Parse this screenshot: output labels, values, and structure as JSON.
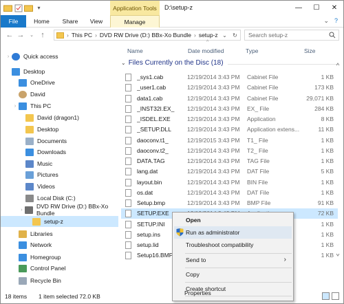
{
  "window": {
    "title": "D:\\setup-z",
    "contextual_group": "Application Tools",
    "controls": [
      "minimize",
      "maximize",
      "close"
    ]
  },
  "ribbon": {
    "tabs": [
      "File",
      "Home",
      "Share",
      "View",
      "Manage"
    ],
    "file_tab_color": "#1979ca",
    "contextual_color": "#f8e8a0"
  },
  "address": {
    "path": [
      "This PC",
      "DVD RW Drive (D:) BBx-Xo Bundle",
      "setup-z"
    ],
    "search_placeholder": "Search setup-z"
  },
  "nav": {
    "items": [
      {
        "label": "Quick access",
        "icon": "star-icon",
        "indent": 0
      },
      {
        "label": "Desktop",
        "icon": "desktop-icon",
        "indent": 0
      },
      {
        "label": "OneDrive",
        "icon": "cloud-icon",
        "indent": 1
      },
      {
        "label": "David",
        "icon": "user-icon",
        "indent": 1
      },
      {
        "label": "This PC",
        "icon": "computer-icon",
        "indent": 1
      },
      {
        "label": "David (dragon1)",
        "icon": "folder-icon",
        "indent": 2
      },
      {
        "label": "Desktop",
        "icon": "folder-icon",
        "indent": 2
      },
      {
        "label": "Documents",
        "icon": "documents-icon",
        "indent": 2
      },
      {
        "label": "Downloads",
        "icon": "downloads-icon",
        "indent": 2
      },
      {
        "label": "Music",
        "icon": "music-icon",
        "indent": 2
      },
      {
        "label": "Pictures",
        "icon": "pictures-icon",
        "indent": 2
      },
      {
        "label": "Videos",
        "icon": "videos-icon",
        "indent": 2
      },
      {
        "label": "Local Disk (C:)",
        "icon": "drive-icon",
        "indent": 2
      },
      {
        "label": "DVD RW Drive (D:) BBx-Xo Bundle",
        "icon": "dvd-icon",
        "indent": 2
      },
      {
        "label": "setup-z",
        "icon": "folder-icon",
        "indent": 3,
        "selected": true
      },
      {
        "label": "Libraries",
        "icon": "libraries-icon",
        "indent": 1
      },
      {
        "label": "Network",
        "icon": "network-icon",
        "indent": 1
      },
      {
        "label": "Homegroup",
        "icon": "homegroup-icon",
        "indent": 1
      },
      {
        "label": "Control Panel",
        "icon": "control-panel-icon",
        "indent": 1
      },
      {
        "label": "Recycle Bin",
        "icon": "recycle-bin-icon",
        "indent": 1
      }
    ]
  },
  "columns": {
    "name": "Name",
    "date": "Date modified",
    "type": "Type",
    "size": "Size"
  },
  "group": {
    "label": "Files Currently on the Disc (18)"
  },
  "files": [
    {
      "name": "_sys1.cab",
      "date": "12/19/2014 3:43 PM",
      "type": "Cabinet File",
      "size": "1 KB"
    },
    {
      "name": "_user1.cab",
      "date": "12/19/2014 3:43 PM",
      "type": "Cabinet File",
      "size": "173 KB"
    },
    {
      "name": "data1.cab",
      "date": "12/19/2014 3:43 PM",
      "type": "Cabinet File",
      "size": "29,071 KB"
    },
    {
      "name": "_INST32I.EX_",
      "date": "12/19/2014 3:43 PM",
      "type": "EX_ File",
      "size": "284 KB"
    },
    {
      "name": "_ISDEL.EXE",
      "date": "12/19/2014 3:43 PM",
      "type": "Application",
      "size": "8 KB"
    },
    {
      "name": "_SETUP.DLL",
      "date": "12/19/2014 3:43 PM",
      "type": "Application extens...",
      "size": "11 KB"
    },
    {
      "name": "daoconv.t1_",
      "date": "12/19/2015 3:43 PM",
      "type": "T1_ File",
      "size": "1 KB"
    },
    {
      "name": "daoconv.t2_",
      "date": "12/19/2014 3:43 PM",
      "type": "T2_ File",
      "size": "1 KB"
    },
    {
      "name": "DATA.TAG",
      "date": "12/19/2014 3:43 PM",
      "type": "TAG File",
      "size": "1 KB"
    },
    {
      "name": "lang.dat",
      "date": "12/19/2014 3:43 PM",
      "type": "DAT File",
      "size": "5 KB"
    },
    {
      "name": "layout.bin",
      "date": "12/19/2014 3:43 PM",
      "type": "BIN File",
      "size": "1 KB"
    },
    {
      "name": "os.dat",
      "date": "12/19/2014 3:43 PM",
      "type": "DAT File",
      "size": "1 KB"
    },
    {
      "name": "Setup.bmp",
      "date": "12/19/2014 3:43 PM",
      "type": "BMP File",
      "size": "91 KB"
    },
    {
      "name": "SETUP.EXE",
      "date": "12/19/2014 3:43 PM",
      "type": "Application",
      "size": "72 KB",
      "selected": true
    },
    {
      "name": "SETUP.INI",
      "date": "",
      "type": "",
      "size": "1 KB"
    },
    {
      "name": "setup.ins",
      "date": "",
      "type": "",
      "size": "1 KB"
    },
    {
      "name": "setup.lid",
      "date": "",
      "type": "",
      "size": "1 KB"
    },
    {
      "name": "Setup16.BMP",
      "date": "",
      "type": "",
      "size": "1 KB"
    }
  ],
  "context_menu": {
    "items": [
      {
        "label": "Open"
      },
      {
        "label": "Run as administrator",
        "shield": true,
        "highlighted": true
      },
      {
        "label": "Troubleshoot compatibility"
      },
      {
        "label": "Send to",
        "submenu": true
      },
      {
        "label": "Copy"
      },
      {
        "label": "Create shortcut"
      },
      {
        "label": "Properties"
      }
    ]
  },
  "status": {
    "count": "18 items",
    "selection": "1 item selected  72.0 KB"
  }
}
